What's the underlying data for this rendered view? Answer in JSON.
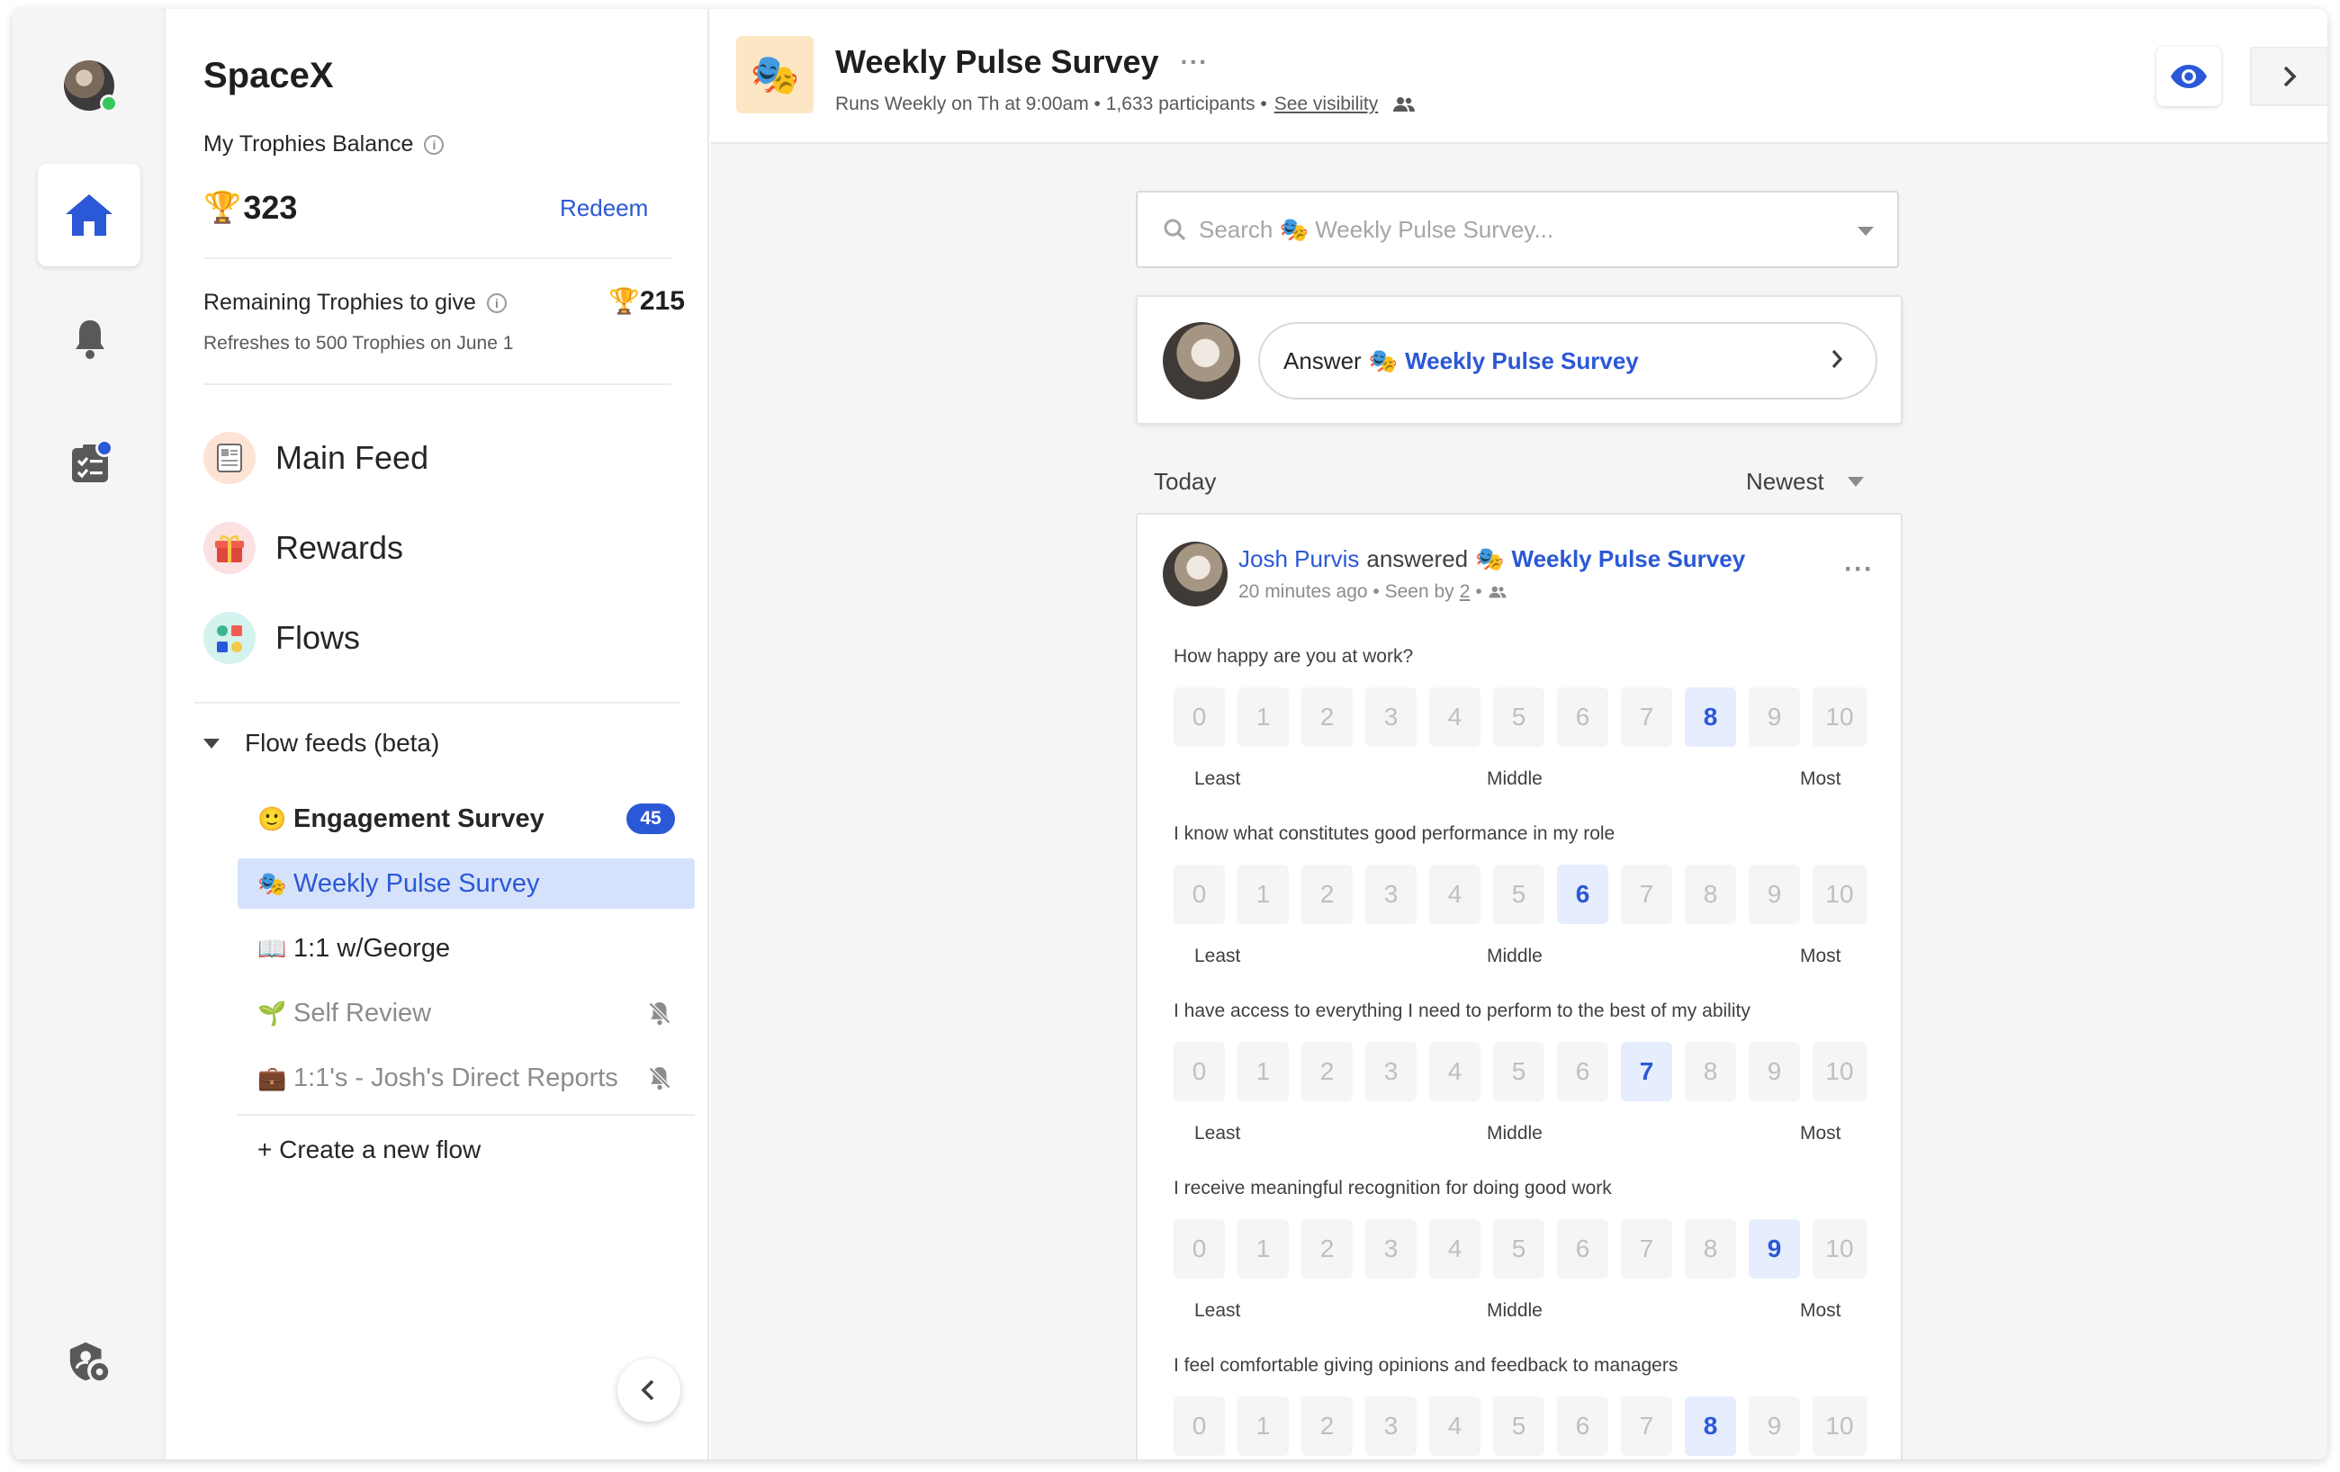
{
  "org": {
    "name": "SpaceX"
  },
  "trophies": {
    "balance_label": "My Trophies Balance",
    "balance": "323",
    "redeem_label": "Redeem",
    "remaining_label": "Remaining Trophies to give",
    "remaining": "215",
    "refresh_note": "Refreshes to 500 Trophies on June 1"
  },
  "nav": [
    {
      "label": "Main Feed",
      "icon": "main-feed-icon"
    },
    {
      "label": "Rewards",
      "icon": "rewards-icon"
    },
    {
      "label": "Flows",
      "icon": "flows-icon"
    }
  ],
  "flow_feeds": {
    "label": "Flow feeds (beta)",
    "items": [
      {
        "emoji": "🙂",
        "label": "Engagement Survey",
        "count": "45",
        "state": "bold"
      },
      {
        "emoji": "🎭",
        "label": "Weekly Pulse Survey",
        "state": "active"
      },
      {
        "emoji": "📖",
        "label": "1:1 w/George",
        "state": "normal"
      },
      {
        "emoji": "🌱",
        "label": "Self Review",
        "state": "muted",
        "muted_icon": "bell-off-icon"
      },
      {
        "emoji": "💼",
        "label": "1:1's - Josh's Direct Reports",
        "state": "muted",
        "muted_icon": "bell-off-icon"
      }
    ],
    "create_label": "+ Create a new flow"
  },
  "header": {
    "emoji": "🎭",
    "title": "Weekly Pulse Survey",
    "meta": "Runs Weekly on Th at 9:00am • 1,633 participants •",
    "visibility_link": "See visibility"
  },
  "search": {
    "placeholder": "Search 🎭 Weekly Pulse Survey..."
  },
  "answer": {
    "prefix": "Answer",
    "emoji": "🎭",
    "flow_name": "Weekly Pulse Survey"
  },
  "feed": {
    "section": "Today",
    "sort": "Newest"
  },
  "post": {
    "author": "Josh Purvis",
    "verb": "answered",
    "emoji": "🎭",
    "flow_name": "Weekly Pulse Survey",
    "time": "20 minutes ago • Seen by",
    "seen_count": "2",
    "seen_suffix": "•",
    "scale_labels": {
      "low": "Least",
      "mid": "Middle",
      "high": "Most"
    },
    "questions": [
      {
        "text": "How happy are you at work?",
        "selected": 8
      },
      {
        "text": "I know what constitutes good performance in my role",
        "selected": 6
      },
      {
        "text": "I have access to everything I need to perform to the best of my ability",
        "selected": 7
      },
      {
        "text": "I receive meaningful recognition for doing good work",
        "selected": 9
      },
      {
        "text": "I feel comfortable giving opinions and feedback to managers",
        "selected": 8
      }
    ]
  },
  "colors": {
    "accent": "#2b58d6",
    "active_bg": "#d6e2fb",
    "online": "#34c759"
  }
}
